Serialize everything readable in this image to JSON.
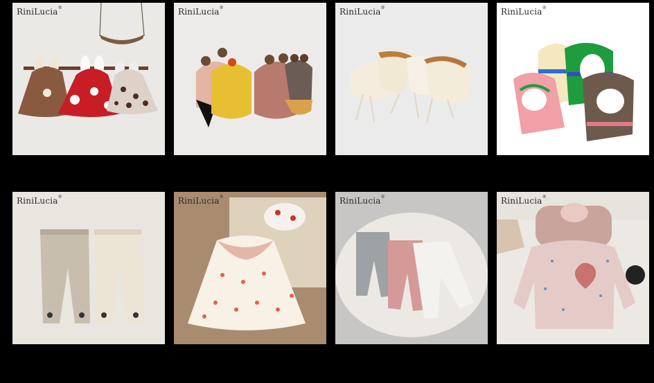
{
  "gallery": {
    "brand": "RiniLucia",
    "brand_mark": "®",
    "products": [
      {
        "bg": "#ebe9e6",
        "theme": "capes"
      },
      {
        "bg": "#ecebea",
        "theme": "hats"
      },
      {
        "bg": "#ebebeb",
        "theme": "bonnets"
      },
      {
        "bg": "#ffffff",
        "theme": "balaclavas"
      },
      {
        "bg": "#e9e6e0",
        "theme": "footed-pants"
      },
      {
        "bg": "#b59b82",
        "theme": "floral-dress"
      },
      {
        "bg": "#c8c6c4",
        "theme": "leggings"
      },
      {
        "bg": "#ece8e3",
        "theme": "sweater"
      }
    ]
  }
}
